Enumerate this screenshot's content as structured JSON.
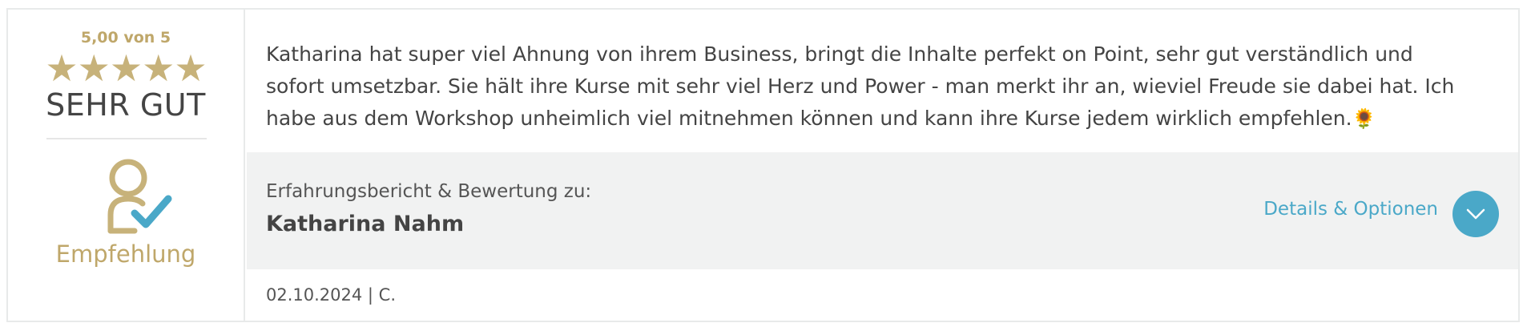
{
  "rating": {
    "score_text": "5,00 von 5",
    "value": 5,
    "max": 5,
    "verdict": "SEHR GUT",
    "star_color": "#c7b27a"
  },
  "recommendation": {
    "icon": "user-check-icon",
    "label": "Empfehlung"
  },
  "review": {
    "text": "Katharina hat super viel Ahnung von ihrem Business, bringt die Inhalte perfekt on Point, sehr gut verständlich und sofort umsetzbar. Sie hält ihre Kurse mit sehr viel Herz und Power - man merkt ihr an, wieviel Freude sie dabei hat. Ich habe aus dem Workshop unheimlich viel mitnehmen können und kann ihre Kurse jedem wirklich empfehlen.",
    "emoji": "🌻"
  },
  "author": {
    "label": "Erfahrungsbericht & Bewertung zu:",
    "name": "Katharina Nahm"
  },
  "details": {
    "label": "Details & Optionen",
    "icon": "chevron-down-icon",
    "color": "#4aa8c8"
  },
  "meta": {
    "date_line": "02.10.2024 | C."
  },
  "colors": {
    "gold": "#bfa76a",
    "accent": "#4aa8c8",
    "band": "#f1f2f2",
    "text": "#444444"
  }
}
